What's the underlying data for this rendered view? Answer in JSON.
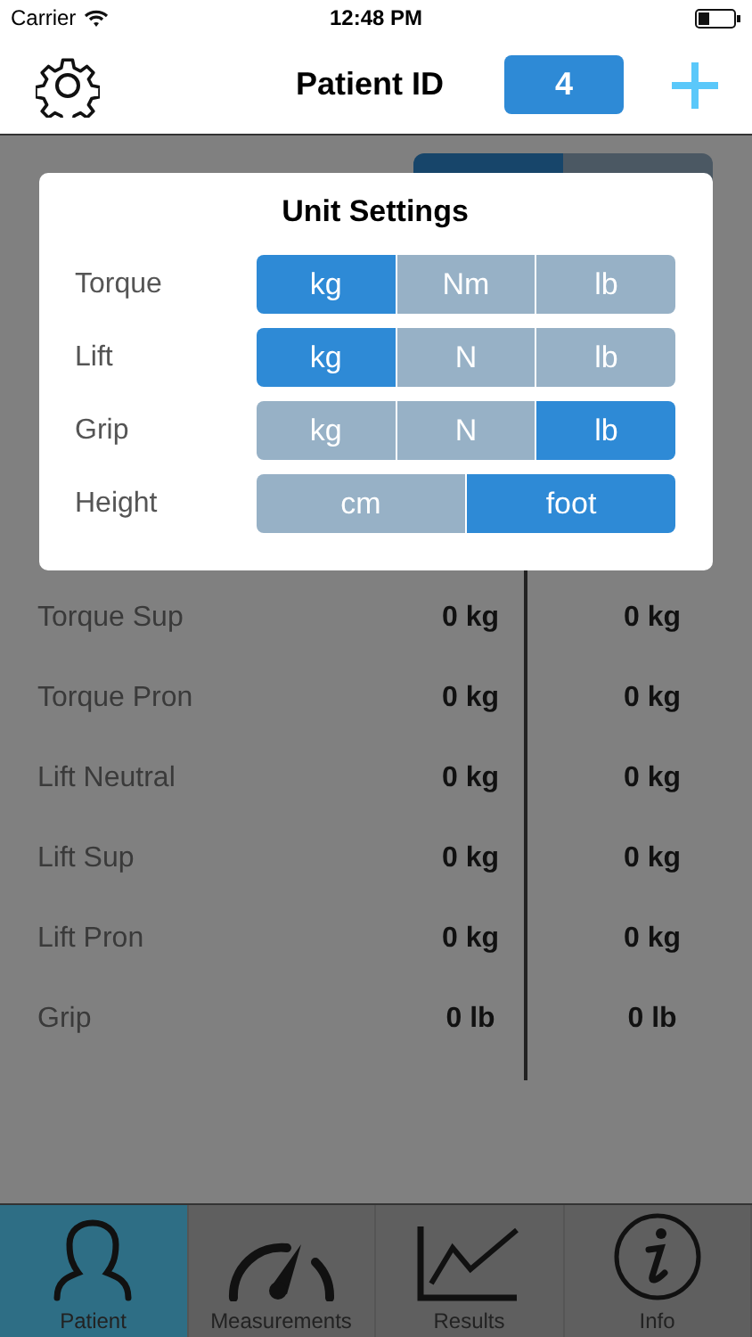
{
  "status_bar": {
    "carrier": "Carrier",
    "time": "12:48 PM"
  },
  "nav_bar": {
    "title": "Patient ID",
    "patient_id": "4"
  },
  "side_switch": [
    {
      "selected": true
    },
    {
      "selected": false
    }
  ],
  "measurements": [
    {
      "label": "Torque Sup",
      "right": "0 kg",
      "left": "0 kg"
    },
    {
      "label": "Torque Pron",
      "right": "0 kg",
      "left": "0 kg"
    },
    {
      "label": "Lift Neutral",
      "right": "0 kg",
      "left": "0 kg"
    },
    {
      "label": "Lift Sup",
      "right": "0 kg",
      "left": "0 kg"
    },
    {
      "label": "Lift Pron",
      "right": "0 kg",
      "left": "0 kg"
    },
    {
      "label": "Grip",
      "right": "0 lb",
      "left": "0 lb"
    }
  ],
  "dialog": {
    "title": "Unit Settings",
    "rows": [
      {
        "label": "Torque",
        "options": [
          {
            "label": "kg",
            "selected": true
          },
          {
            "label": "Nm",
            "selected": false
          },
          {
            "label": "lb",
            "selected": false
          }
        ]
      },
      {
        "label": "Lift",
        "options": [
          {
            "label": "kg",
            "selected": true
          },
          {
            "label": "N",
            "selected": false
          },
          {
            "label": "lb",
            "selected": false
          }
        ]
      },
      {
        "label": "Grip",
        "options": [
          {
            "label": "kg",
            "selected": false
          },
          {
            "label": "N",
            "selected": false
          },
          {
            "label": "lb",
            "selected": true
          }
        ]
      },
      {
        "label": "Height",
        "options": [
          {
            "label": "cm",
            "selected": false
          },
          {
            "label": "foot",
            "selected": true
          }
        ]
      }
    ]
  },
  "tabs": [
    {
      "label": "Patient",
      "selected": true
    },
    {
      "label": "Measurements",
      "selected": false
    },
    {
      "label": "Results",
      "selected": false
    },
    {
      "label": "Info",
      "selected": false
    }
  ]
}
